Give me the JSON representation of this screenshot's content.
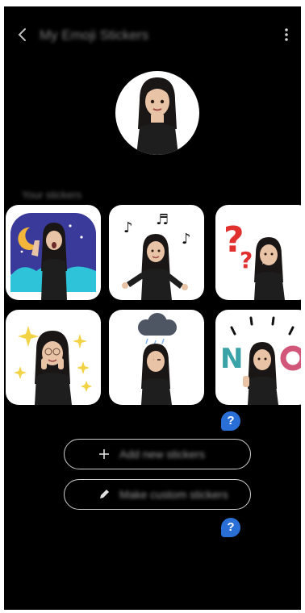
{
  "appbar": {
    "title": "My Emoji Stickers",
    "back_icon": "chevron-left-icon",
    "more_icon": "more-vertical-icon"
  },
  "section": {
    "label": "Your stickers"
  },
  "stickers": [
    {
      "name": "night-yawn-sticker"
    },
    {
      "name": "music-notes-sticker"
    },
    {
      "name": "question-marks-sticker"
    },
    {
      "name": "sparkles-sticker"
    },
    {
      "name": "rain-cloud-sticker"
    },
    {
      "name": "no-sticker"
    }
  ],
  "actions": {
    "add_label": "Add new stickers",
    "custom_label": "Make custom stickers"
  },
  "help_badge": "?",
  "colors": {
    "background": "#000000",
    "tile": "#ffffff",
    "help_badge": "#2a6fd6",
    "pill_border": "#cfcfcf"
  }
}
